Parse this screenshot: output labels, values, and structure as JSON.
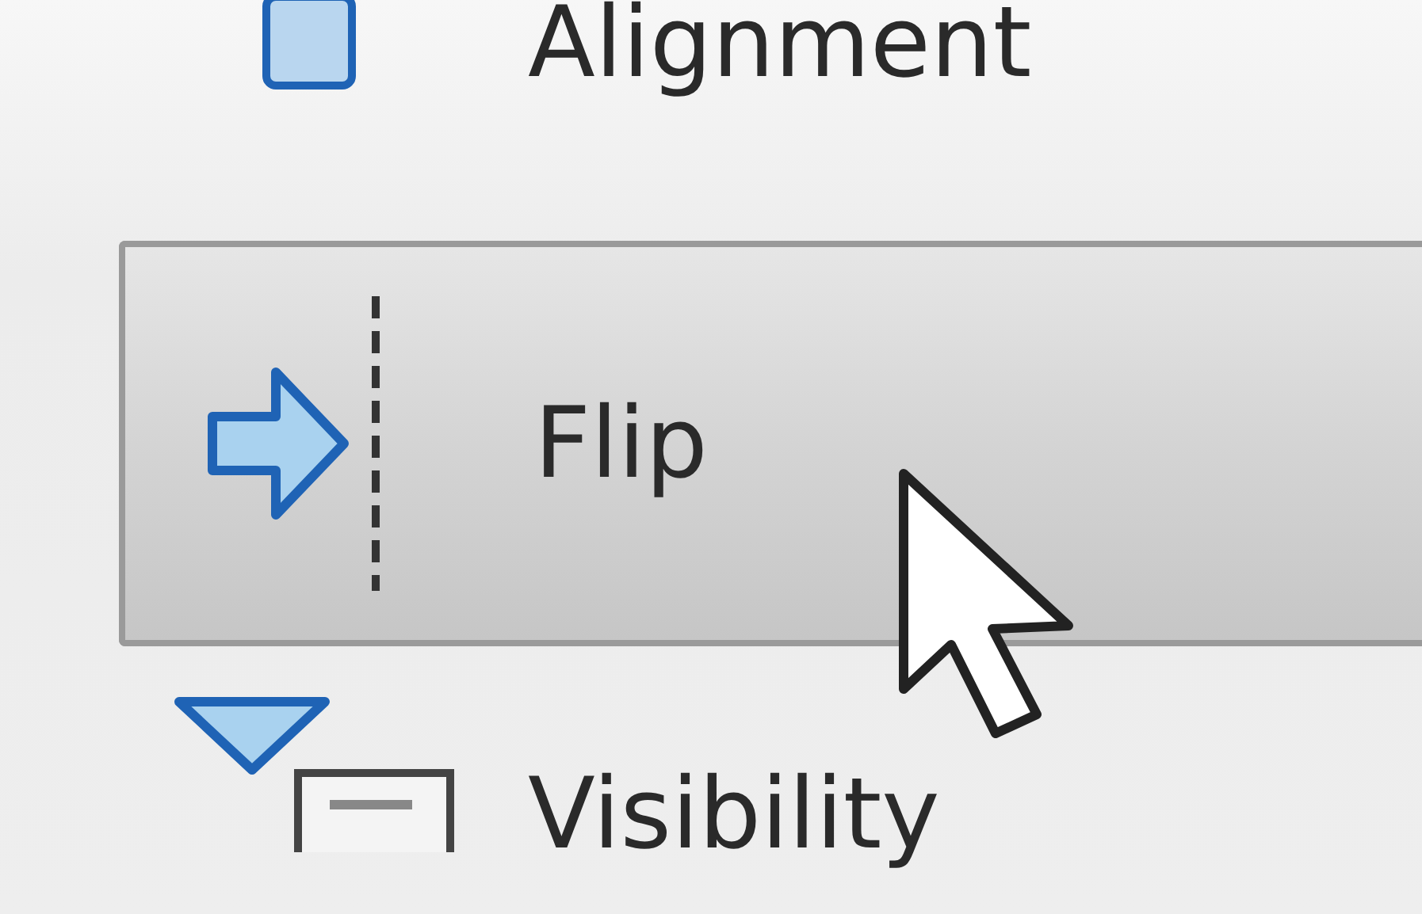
{
  "menu_items": [
    {
      "label": "Alignment",
      "hovered": false
    },
    {
      "label": "Flip",
      "hovered": true
    },
    {
      "label": "Visibility",
      "hovered": false
    }
  ]
}
